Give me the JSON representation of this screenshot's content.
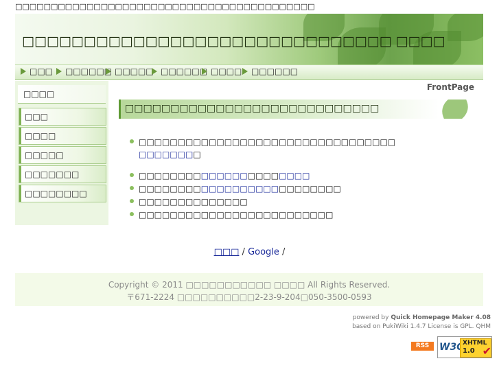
{
  "top_text": "□□□□□□□□□□□□□□□□□□□□□□□□□□□□□□□□□□□□□□□□□□",
  "header": {
    "site_title": "□□□□□□□□□□□□□□□□□□□□□□□□□□□□□□ □□□□"
  },
  "nav": [
    {
      "label": "□□□"
    },
    {
      "label": "□□□□□□"
    },
    {
      "label": "□□□□□"
    },
    {
      "label": "□□□□□□"
    },
    {
      "label": "□□□□"
    },
    {
      "label": "□□□□□□"
    }
  ],
  "sidebar": {
    "heading": "□□□□",
    "items": [
      {
        "label": "□□□"
      },
      {
        "label": "□□□□"
      },
      {
        "label": "□□□□□"
      },
      {
        "label": "□□□□□□□"
      },
      {
        "label": "□□□□□□□□"
      }
    ]
  },
  "main": {
    "page_name": "FrontPage",
    "banner_title": "□□□□□□□□□□□□□□□□□□□□□□□□□□□□",
    "items": [
      {
        "pre": "□□□□□□□□□□□□□□□□□□□□□□□□□□□□□□□□□",
        "link": "",
        "post": ""
      },
      {
        "pre": "",
        "link": "□□□□□□□",
        "post": "□"
      },
      {
        "pre": "□□□□□□□□",
        "link": "□□□□□□",
        "mid": "□□□□",
        "link2": "□□□□"
      },
      {
        "pre": "□□□□□□□□",
        "link": "□□□□□□□□□□",
        "post": "□□□□□□□□"
      },
      {
        "pre": "□□□□□□□□□□□□□□",
        "link": "",
        "post": ""
      },
      {
        "pre": "□□□□□□□□□□□□□□□□□□□□□□□□□",
        "link": "",
        "post": ""
      }
    ]
  },
  "footer_links": {
    "a": "□□□",
    "sep1": " / ",
    "b": "Google",
    "sep2": " /"
  },
  "footer": {
    "copyright": "Copyright © 2011 □□□□□□□□□□□ □□□□ All Rights Reserved.",
    "address": "〒671-2224 □□□□□□□□□□2-23-9-204□050-3500-0593"
  },
  "powered": {
    "line1_pre": "powered by ",
    "line1_bold": "Quick Homepage Maker 4.08",
    "line2": "based on PukiWiki 1.4.7 License is GPL. QHM"
  },
  "badges": {
    "rss": "RSS",
    "w3c": "W3C",
    "xhtml": "XHTML",
    "version": "1.0"
  }
}
